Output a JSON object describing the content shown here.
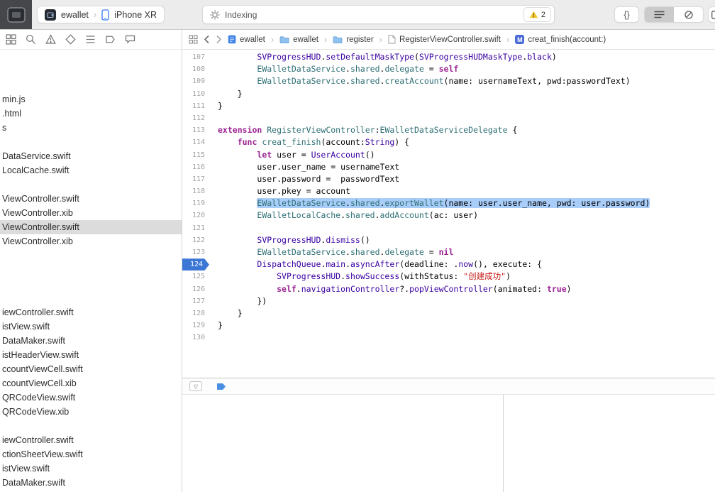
{
  "toolbar": {
    "scheme_label": "ewallet",
    "device_label": "iPhone XR",
    "activity_text": "Indexing",
    "warning_count": "2",
    "code_structure_label": "{}",
    "separator": "›",
    "icons": [
      "window-app-icon",
      "scheme-app-icon",
      "device-phone-icon",
      "activity-gear-icon",
      "warning-triangle-icon",
      "editor-lines-icon",
      "editor-circle-icon",
      "inspector-toggle-icon"
    ]
  },
  "navigator_bar": {
    "icons": [
      "project-navigator-icon",
      "search-navigator-icon",
      "issue-navigator-icon",
      "test-navigator-icon",
      "debug-navigator-icon",
      "breakpoint-navigator-icon",
      "report-navigator-icon"
    ]
  },
  "jumpbar": {
    "separator": "›",
    "items": [
      {
        "label": "ewallet",
        "icon": "project-file-icon"
      },
      {
        "label": "ewallet",
        "icon": "group-folder-icon"
      },
      {
        "label": "register",
        "icon": "group-folder-icon"
      },
      {
        "label": "RegisterViewController.swift",
        "icon": "swift-file-icon"
      },
      {
        "label": "creat_finish(account:)",
        "icon": "method-badge",
        "badge": "M"
      }
    ]
  },
  "sidebar": {
    "files": [
      null,
      null,
      null,
      {
        "label": "min.js"
      },
      {
        "label": ".html"
      },
      {
        "label": "s"
      },
      null,
      {
        "label": "DataService.swift"
      },
      {
        "label": "LocalCache.swift"
      },
      null,
      {
        "label": "ViewController.swift"
      },
      {
        "label": "ViewController.xib"
      },
      {
        "label": "ViewController.swift",
        "selected": true
      },
      {
        "label": "ViewController.xib"
      },
      null,
      null,
      null,
      null,
      {
        "label": "iewController.swift"
      },
      {
        "label": "istView.swift"
      },
      {
        "label": "DataMaker.swift"
      },
      {
        "label": "istHeaderView.swift"
      },
      {
        "label": "ccountViewCell.swift"
      },
      {
        "label": "ccountViewCell.xib"
      },
      {
        "label": "QRCodeView.swift"
      },
      {
        "label": "QRCodeView.xib"
      },
      null,
      {
        "label": "iewController.swift"
      },
      {
        "label": "ctionSheetView.swift"
      },
      {
        "label": "istView.swift"
      },
      {
        "label": "DataMaker.swift"
      }
    ]
  },
  "editor": {
    "lines": [
      {
        "n": "107",
        "toks": [
          [
            "        ",
            "p"
          ],
          [
            "SVProgressHUD",
            "t"
          ],
          [
            ".",
            "p"
          ],
          [
            "setDefaultMaskType",
            "t"
          ],
          [
            "(",
            "p"
          ],
          [
            "SVProgressHUDMaskType",
            "t"
          ],
          [
            ".",
            "p"
          ],
          [
            "black",
            "t"
          ],
          [
            ")",
            "p"
          ]
        ]
      },
      {
        "n": "108",
        "toks": [
          [
            "        ",
            "p"
          ],
          [
            "EWalletDataService",
            "c"
          ],
          [
            ".",
            "p"
          ],
          [
            "shared",
            "c"
          ],
          [
            ".",
            "p"
          ],
          [
            "delegate",
            "c"
          ],
          [
            " = ",
            "p"
          ],
          [
            "self",
            "k"
          ]
        ]
      },
      {
        "n": "109",
        "toks": [
          [
            "        ",
            "p"
          ],
          [
            "EWalletDataService",
            "c"
          ],
          [
            ".",
            "p"
          ],
          [
            "shared",
            "c"
          ],
          [
            ".",
            "p"
          ],
          [
            "creatAccount",
            "c"
          ],
          [
            "(name: usernameText, pwd:passwordText)",
            "p"
          ]
        ]
      },
      {
        "n": "110",
        "toks": [
          [
            "    }",
            "p"
          ]
        ]
      },
      {
        "n": "111",
        "toks": [
          [
            "}",
            "p"
          ]
        ]
      },
      {
        "n": "112",
        "toks": []
      },
      {
        "n": "113",
        "toks": [
          [
            "extension",
            "k"
          ],
          [
            " ",
            "p"
          ],
          [
            "RegisterViewController",
            "c"
          ],
          [
            ":",
            "p"
          ],
          [
            "EWalletDataServiceDelegate",
            "c"
          ],
          [
            " {",
            "p"
          ]
        ]
      },
      {
        "n": "114",
        "toks": [
          [
            "    ",
            "p"
          ],
          [
            "func",
            "k"
          ],
          [
            " ",
            "p"
          ],
          [
            "creat_finish",
            "c"
          ],
          [
            "(account:",
            "p"
          ],
          [
            "String",
            "t"
          ],
          [
            ") {",
            "p"
          ]
        ]
      },
      {
        "n": "115",
        "toks": [
          [
            "        ",
            "p"
          ],
          [
            "let",
            "k"
          ],
          [
            " user = ",
            "p"
          ],
          [
            "UserAccount",
            "t"
          ],
          [
            "()",
            "p"
          ]
        ]
      },
      {
        "n": "116",
        "toks": [
          [
            "        user.user_name = usernameText",
            "p"
          ]
        ]
      },
      {
        "n": "117",
        "toks": [
          [
            "        user.password =  passwordText",
            "p"
          ]
        ]
      },
      {
        "n": "118",
        "toks": [
          [
            "        user.pkey = account",
            "p"
          ]
        ]
      },
      {
        "n": "119",
        "sel": true,
        "toks": [
          [
            "        ",
            "p"
          ],
          [
            "EWalletDataService",
            "c"
          ],
          [
            ".",
            "p"
          ],
          [
            "shared",
            "c"
          ],
          [
            ".",
            "p"
          ],
          [
            "exportWallet",
            "c"
          ],
          [
            "(name: user.user_name, pwd: user.password)",
            "p"
          ]
        ]
      },
      {
        "n": "120",
        "toks": [
          [
            "        ",
            "p"
          ],
          [
            "EWalletLocalCache",
            "c"
          ],
          [
            ".",
            "p"
          ],
          [
            "shared",
            "c"
          ],
          [
            ".",
            "p"
          ],
          [
            "addAccount",
            "c"
          ],
          [
            "(ac: user)",
            "p"
          ]
        ]
      },
      {
        "n": "121",
        "toks": []
      },
      {
        "n": "122",
        "toks": [
          [
            "        ",
            "p"
          ],
          [
            "SVProgressHUD",
            "t"
          ],
          [
            ".",
            "p"
          ],
          [
            "dismiss",
            "t"
          ],
          [
            "()",
            "p"
          ]
        ]
      },
      {
        "n": "123",
        "toks": [
          [
            "        ",
            "p"
          ],
          [
            "EWalletDataService",
            "c"
          ],
          [
            ".",
            "p"
          ],
          [
            "shared",
            "c"
          ],
          [
            ".",
            "p"
          ],
          [
            "delegate",
            "c"
          ],
          [
            " = ",
            "p"
          ],
          [
            "nil",
            "k"
          ]
        ]
      },
      {
        "n": "124",
        "bp": true,
        "toks": [
          [
            "        ",
            "p"
          ],
          [
            "DispatchQueue",
            "t"
          ],
          [
            ".",
            "p"
          ],
          [
            "main",
            "t"
          ],
          [
            ".",
            "p"
          ],
          [
            "asyncAfter",
            "t"
          ],
          [
            "(deadline: .",
            "p"
          ],
          [
            "now",
            "t"
          ],
          [
            "(), execute: {",
            "p"
          ]
        ]
      },
      {
        "n": "125",
        "toks": [
          [
            "            ",
            "p"
          ],
          [
            "SVProgressHUD",
            "t"
          ],
          [
            ".",
            "p"
          ],
          [
            "showSuccess",
            "t"
          ],
          [
            "(withStatus: ",
            "p"
          ],
          [
            "\"创建成功\"",
            "s"
          ],
          [
            ")",
            "p"
          ]
        ]
      },
      {
        "n": "126",
        "toks": [
          [
            "            ",
            "p"
          ],
          [
            "self",
            "k"
          ],
          [
            ".",
            "p"
          ],
          [
            "navigationController",
            "t"
          ],
          [
            "?.",
            "p"
          ],
          [
            "popViewController",
            "t"
          ],
          [
            "(animated: ",
            "p"
          ],
          [
            "true",
            "k"
          ],
          [
            ")",
            "p"
          ]
        ]
      },
      {
        "n": "127",
        "toks": [
          [
            "        })",
            "p"
          ]
        ]
      },
      {
        "n": "128",
        "toks": [
          [
            "    }",
            "p"
          ]
        ]
      },
      {
        "n": "129",
        "toks": [
          [
            "}",
            "p"
          ]
        ]
      },
      {
        "n": "130",
        "toks": []
      }
    ]
  },
  "debug_bar": {
    "filter_glyph": "▽",
    "icons": [
      "filter-disclosure-icon",
      "breakpoint-toggle-icon"
    ]
  },
  "colors": {
    "selection_highlight": "#A9CDF9",
    "breakpoint_blue": "#3C77D6",
    "keyword_pink": "#9B2393",
    "framework_type_purple": "#3900A0",
    "project_type_teal": "#2E6F74",
    "string_red": "#C41A16",
    "warning_yellow": "#F5C732",
    "sidebar_selection_gray": "#DCDCDC"
  }
}
